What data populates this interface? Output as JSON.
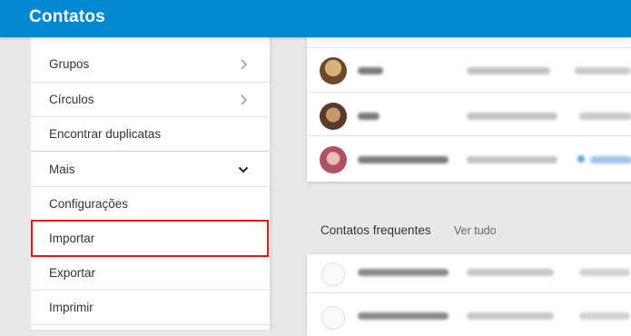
{
  "app": {
    "title": "Contatos"
  },
  "sidebar": {
    "items": [
      {
        "label": "Grupos",
        "chevron": "chevron-right-icon"
      },
      {
        "label": "Círculos",
        "chevron": "chevron-right-icon"
      },
      {
        "label": "Encontrar duplicatas"
      },
      {
        "label": "Mais",
        "chevron": "chevron-down-icon"
      },
      {
        "label": "Configurações"
      },
      {
        "label": "Importar",
        "highlighted": true
      },
      {
        "label": "Exportar"
      },
      {
        "label": "Imprimir"
      }
    ]
  },
  "frequent": {
    "title": "Contatos frequentes",
    "see_all": "Ver tudo"
  },
  "colors": {
    "header": "#0288d1",
    "highlight_border": "#e01a1a"
  }
}
